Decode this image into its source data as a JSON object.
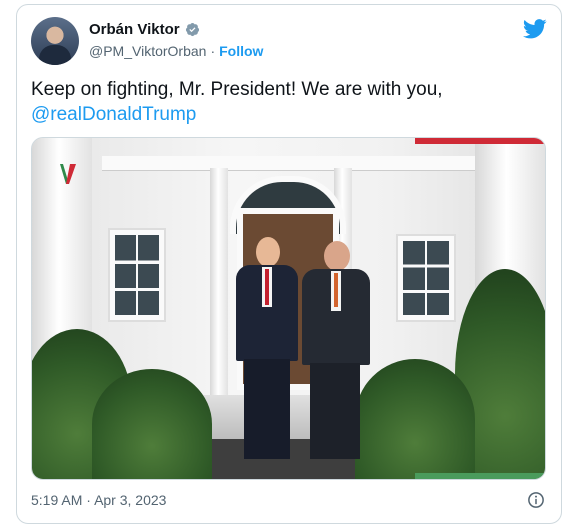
{
  "tweet": {
    "author_name": "Orbán Viktor",
    "handle": "@PM_ViktorOrban",
    "separator": "·",
    "follow_label": "Follow",
    "text": "Keep on fighting, Mr. President! We are with you,",
    "mention": "@realDonaldTrump",
    "time": "5:19 AM",
    "date_separator": "·",
    "date": "Apr 3, 2023"
  },
  "colors": {
    "accent": "#1d9bf0",
    "text": "#0f1419",
    "muted": "#536471",
    "border": "#cfd9de"
  },
  "icons": [
    "verified-badge-icon",
    "twitter-bird-icon",
    "info-icon"
  ]
}
